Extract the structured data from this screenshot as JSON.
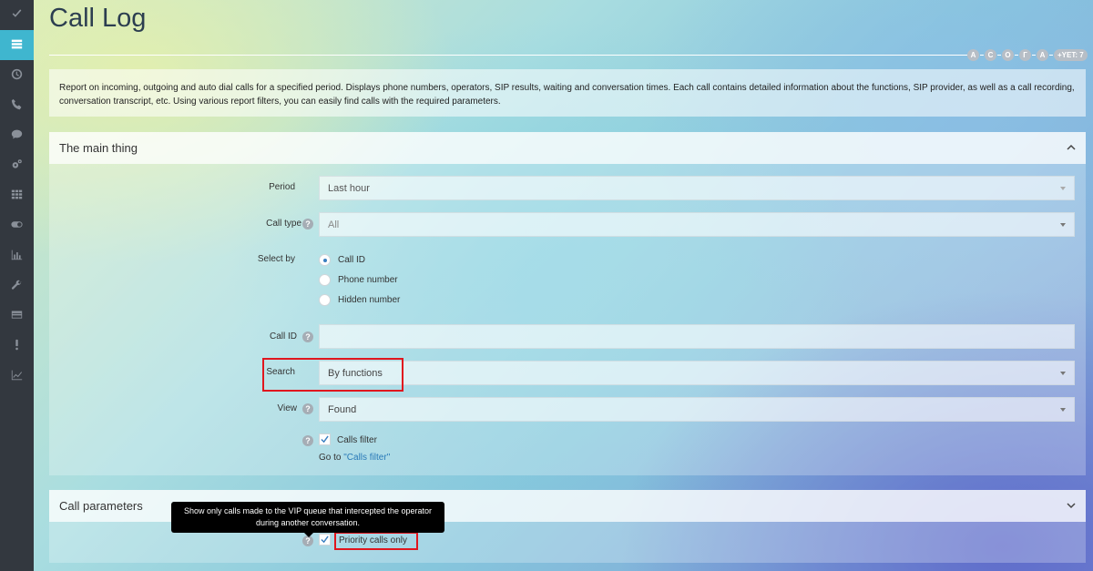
{
  "header": {
    "title": "Call Log",
    "letters": [
      "A",
      "C",
      "O",
      "Г",
      "A"
    ],
    "more_badge": "+YET: 7"
  },
  "description": "Report on incoming, outgoing and auto dial calls for a specified period. Displays phone numbers, operators, SIP results, waiting and conversation times. Each call contains detailed information about the functions, SIP provider, as well as a call recording, conversation transcript, etc. Using various report filters, you can easily find calls with the required parameters.",
  "sidebar": {
    "items": [
      "check-icon",
      "list-icon",
      "clock-icon",
      "phone-icon",
      "chat-icon",
      "gears-icon",
      "grid-icon",
      "toggle-icon",
      "bar-chart-icon",
      "wrench-icon",
      "card-icon",
      "exclamation-icon",
      "line-chart-icon"
    ],
    "active_index": 1
  },
  "main_panel": {
    "title": "The main thing",
    "period": {
      "label": "Period",
      "value": "Last hour"
    },
    "call_type": {
      "label": "Call type",
      "value": "All"
    },
    "select_by": {
      "label": "Select by",
      "options": [
        "Call ID",
        "Phone number",
        "Hidden number"
      ],
      "selected": "Call ID"
    },
    "call_id": {
      "label": "Call ID",
      "value": ""
    },
    "search": {
      "label": "Search",
      "value": "By functions"
    },
    "view": {
      "label": "View",
      "value": "Found"
    },
    "calls_filter": {
      "label": "Calls filter",
      "checked": true,
      "goto_prefix": "Go to ",
      "goto_link": "\"Calls filter\""
    }
  },
  "call_panel": {
    "title": "Call parameters",
    "tooltip": "Show only calls made to the VIP queue that intercepted the operator during another conversation.",
    "priority": {
      "label": "Priority calls only",
      "checked": true
    }
  },
  "colors": {
    "sidebar_bg": "#33383f",
    "accent": "#3fb6cf",
    "highlight": "#e0161e",
    "link": "#2a7ab8"
  }
}
